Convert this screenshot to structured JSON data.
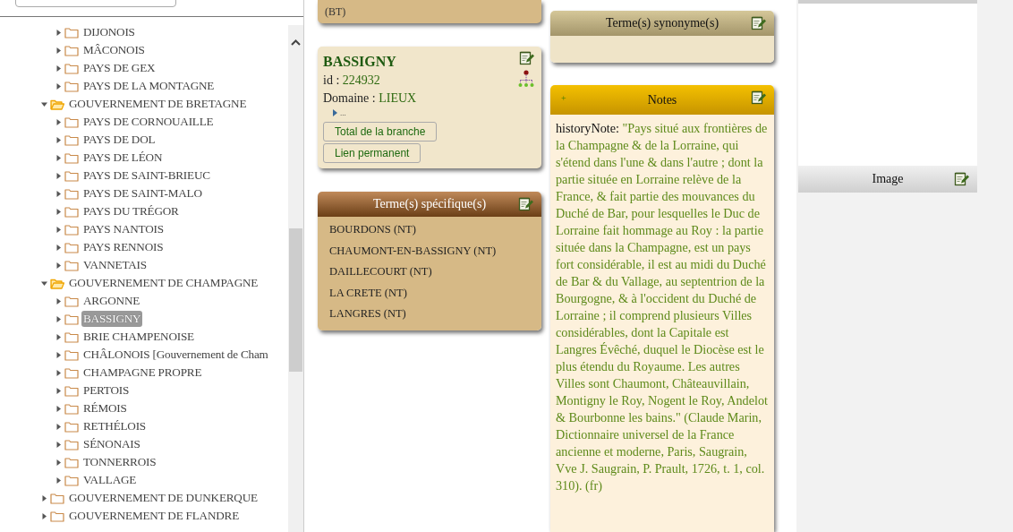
{
  "sidebar": {
    "tree": {
      "continued_children": [
        {
          "label": "DIJONOIS",
          "expanded": false,
          "selected": false
        },
        {
          "label": "MÂCONOIS",
          "expanded": false,
          "selected": false
        },
        {
          "label": "PAYS DE GEX",
          "expanded": false,
          "selected": false
        },
        {
          "label": "PAYS DE LA MONTAGNE",
          "expanded": false,
          "selected": false
        }
      ],
      "items": [
        {
          "label": "GOUVERNEMENT DE BRETAGNE",
          "expanded": true,
          "selected": false,
          "children": [
            {
              "label": "PAYS DE CORNOUAILLE",
              "expanded": false,
              "selected": false
            },
            {
              "label": "PAYS DE DOL",
              "expanded": false,
              "selected": false
            },
            {
              "label": "PAYS DE LÉON",
              "expanded": false,
              "selected": false
            },
            {
              "label": "PAYS DE SAINT-BRIEUC",
              "expanded": false,
              "selected": false
            },
            {
              "label": "PAYS DE SAINT-MALO",
              "expanded": false,
              "selected": false
            },
            {
              "label": "PAYS DU TRÉGOR",
              "expanded": false,
              "selected": false
            },
            {
              "label": "PAYS NANTOIS",
              "expanded": false,
              "selected": false
            },
            {
              "label": "PAYS RENNOIS",
              "expanded": false,
              "selected": false
            },
            {
              "label": "VANNETAIS",
              "expanded": false,
              "selected": false
            }
          ]
        },
        {
          "label": "GOUVERNEMENT DE CHAMPAGNE",
          "expanded": true,
          "selected": false,
          "children": [
            {
              "label": "ARGONNE",
              "expanded": false,
              "selected": false
            },
            {
              "label": "BASSIGNY",
              "expanded": false,
              "selected": true
            },
            {
              "label": "BRIE CHAMPENOISE",
              "expanded": false,
              "selected": false
            },
            {
              "label": "CHÂLONOIS [Gouvernement de Cham",
              "expanded": false,
              "selected": false
            },
            {
              "label": "CHAMPAGNE PROPRE",
              "expanded": false,
              "selected": false
            },
            {
              "label": "PERTOIS",
              "expanded": false,
              "selected": false
            },
            {
              "label": "RÉMOIS",
              "expanded": false,
              "selected": false
            },
            {
              "label": "RETHÉLOIS",
              "expanded": false,
              "selected": false
            },
            {
              "label": "SÉNONAIS",
              "expanded": false,
              "selected": false
            },
            {
              "label": "TONNERROIS",
              "expanded": false,
              "selected": false
            },
            {
              "label": "VALLAGE",
              "expanded": false,
              "selected": false
            }
          ]
        },
        {
          "label": "GOUVERNEMENT DE DUNKERQUE",
          "expanded": false,
          "selected": false
        },
        {
          "label": "GOUVERNEMENT DE FLANDRE",
          "expanded": false,
          "selected": false
        }
      ]
    }
  },
  "broader_card": {
    "text": "(BT)"
  },
  "concept_card": {
    "title": "BASSIGNY",
    "id_label": "id :",
    "id": "224932",
    "domain_label": "Domaine :",
    "domain": "LIEUX",
    "more": "...",
    "buttons": [
      "Total de la branche",
      "Lien permanent"
    ]
  },
  "narrower_panel": {
    "title": "Terme(s) spécifique(s)",
    "items": [
      "BOURDONS (NT)",
      "CHAUMONT-EN-BASSIGNY (NT)",
      "DAILLECOURT (NT)",
      "LA CRETE (NT)",
      "LANGRES (NT)"
    ]
  },
  "synonyms_panel": {
    "title": "Terme(s) synonyme(s)"
  },
  "notes_panel": {
    "toggle": "+",
    "title": "Notes",
    "label": "historyNote:",
    "text": "\"Pays situé aux frontières de la Champagne & de la Lorraine, qui s'étend dans l'une & dans l'autre ; dont la partie située en Lorraine relève de la France, & fait partie des mouvances du Duché de Bar, pour lesquelles le Duc de Lorraine fait hommage au Roy : la partie située dans la Champagne, est un pays fort considérable, il est au midi du Duché de Bar & du Vallage, au septentrion de la Bourgogne, & à l'occident du Duché de Lorraine ; il comprend plusieurs Villes considérables, dont la Capitale est Langres Évêché, duquel le Diocèse est le plus étendu du Royaume. Les autres Villes sont Chaumont, Châteauvillain, Montigny le Roy, Nogent le Roy, Andelot & Bourbonne les bains.\" (Claude Marin, Dictionnaire universel de la France ancienne et moderne, Paris, Saugrain, Vve J. Saugrain, P. Prault, 1726, t. 1, col. 310). (fr)"
  },
  "image_panel": {
    "title": "Image"
  }
}
